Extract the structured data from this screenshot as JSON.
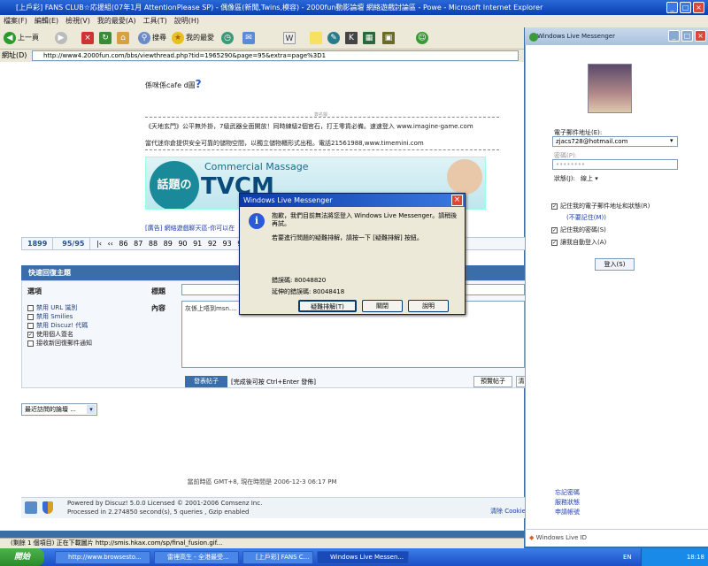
{
  "window": {
    "title": "[上戶彩] FANS CLUB☆応援組(07年1月 AttentionPlease SP) - 偶像區(新聞,Twins,模容) - 2000fun動影論壇 網絡遊戲討論區 - Powe - Microsoft Internet Explorer",
    "min": "_",
    "max": "□",
    "close": "×"
  },
  "menubar": [
    "檔案(F)",
    "編輯(E)",
    "檢視(V)",
    "我的最愛(A)",
    "工具(T)",
    "說明(H)"
  ],
  "toolbar": {
    "back": "上一頁",
    "search": "搜尋",
    "favorites": "我的最愛"
  },
  "address": {
    "label": "網址(D)",
    "url": "http://www4.2000fun.com/bbs/viewthread.php?tid=1965290&page=95&extra=page%3D1"
  },
  "post": {
    "line1": "係咪係cafe d圖",
    "question": "?",
    "sig_tag": "簽名檔",
    "ad1": "《天地玄門》公平無外掛，7級武器全面開放！同時練級2個官石，打王零貨必備。速速登入 www.imagine-game.com",
    "ad2": "當代迷你倉提供安全可靠的儲物空間，以獨立儲物櫃形式出租。電話21561988,www.timemini.com",
    "banner_small": "Commercial Massage",
    "banner_big": "TVCM",
    "banner_jp": "話題の",
    "promo": "[廣告] 網絡遊戲聊天區-你可以在"
  },
  "pager": {
    "total": "1899",
    "current_of": "95/95",
    "first": "|‹",
    "prev": "‹‹",
    "pages": [
      "86",
      "87",
      "88",
      "89",
      "90",
      "91",
      "92",
      "93",
      "94",
      "95"
    ]
  },
  "reply": {
    "header": "快速回復主題",
    "options_label": "選項",
    "title_label": "標題",
    "content_label": "內容",
    "content_value": "灰係上唔到msn....",
    "opts": [
      "禁用 URL 識別",
      "禁用 Smilies",
      "禁用 Discuz! 代碼",
      "使用個人簽名",
      "接收新回復郵件通知"
    ],
    "opts_checked": [
      false,
      false,
      false,
      true,
      false
    ],
    "submit": "發表帖子",
    "hint": "[完成後可按 Ctrl+Enter 發佈]",
    "preview": "預覽帖子",
    "clear": "清"
  },
  "quickjump": "最近訪問的論壇 ...",
  "footer": {
    "time": "當前時區 GMT+8, 現在時間是 2006-12-3 06:17 PM",
    "powered": "Powered by Discuz! 5.0.0 Licensed © 2001-2006 Comsenz Inc.",
    "processed": "Processed in 2.274850 second(s), 5 queries , Gzip enabled",
    "clear_cookie": "清除 Cookie"
  },
  "dialog": {
    "title": "Windows Live Messenger",
    "close": "×",
    "msg1": "抱歉，我們目前無法將您登入 Windows Live Messenger。請稍後再試。",
    "msg2": "若要進行問題的疑難排解，請按一下 [疑難排解] 按鈕。",
    "err_code": "錯誤碼: 80048820",
    "ext_code": "延伸的錯誤碼: 80048418",
    "btn_troubleshoot": "疑難排解(T)",
    "btn_close": "關閉",
    "btn_help": "說明"
  },
  "messenger": {
    "title": "Windows Live Messenger",
    "email_label": "電子郵件地址(E):",
    "email_value": "zjacs728@hotmail.com",
    "password_label": "密碼(P):",
    "password_value": "••••••••",
    "status_label": "狀態(J):",
    "status_value": "線上",
    "remember_me": "記住我的電子郵件地址和狀態(R)",
    "forget_me": "(不要記住(M))",
    "remember_pw": "記住我的密碼(S)",
    "auto_login": "讓我自動登入(A)",
    "login_button": "登入(S)",
    "forgot_pw": "忘記密碼",
    "service_status": "服務狀態",
    "get_account": "申請帳號",
    "footer": "Windows Live ID"
  },
  "statusbar": "(剩餘 1 個項目) 正在下載圖片 http://smis.hkax.com/sp/final_fusion.gif...",
  "taskbar": {
    "start": "開始",
    "tasks": [
      "http://www.browsesto...",
      "雷裡高生 - 全港最受...",
      "[上戶彩] FANS C...",
      "Windows Live Messen..."
    ],
    "lang": "EN",
    "clock": "18:18"
  }
}
